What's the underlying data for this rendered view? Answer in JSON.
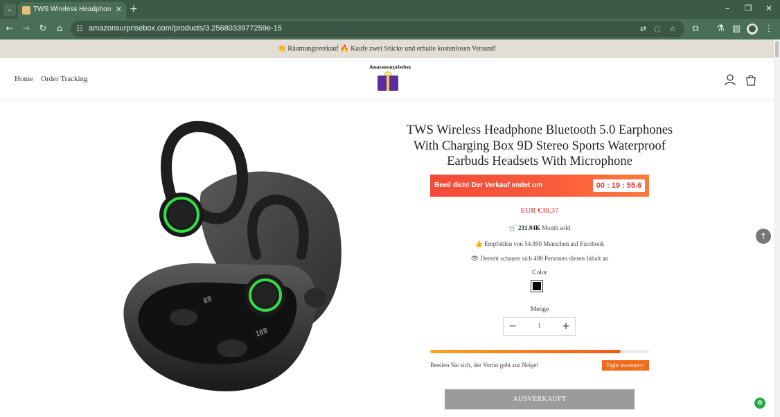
{
  "browser": {
    "tab_title": "TWS Wireless Headphone Blueto",
    "new_tab_icon": "plus-icon",
    "url": "amazonsurprisebox.com/products/3.2568033977259e-15",
    "window_buttons": [
      "minimize-icon",
      "restore-icon",
      "close-icon"
    ]
  },
  "announcement": "👏 Räumungsverkauf 🔥 Kaufe zwei Stücke und erhalte kostenlosen Versand!",
  "nav": {
    "home": "Home",
    "order_tracking": "Order Tracking"
  },
  "logo": {
    "text": "Amazonsurprisebox"
  },
  "product": {
    "title": "TWS Wireless Headphone Bluetooth 5.0 Earphones With Charging Box 9D Stereo Sports Waterproof Earbuds Headsets With Microphone",
    "countdown_label": "Beeil dich! Der Verkauf endet um",
    "countdown_time": "00 : 19 : 55.6",
    "price": "EUR €30,37",
    "sold_count": "231.94K",
    "sold_label": "Month sold",
    "recommended": "Empfohlen von 54.890 Menschen auf Facebook",
    "viewing": "Derzeit schauen sich 498 Personen diesen Inhalt an",
    "color_label": "Color",
    "selected_color": "#000000",
    "quantity_label": "Menge",
    "quantity": "1",
    "stock_level": 0.87,
    "stock_text": "Beeilen Sie sich, der Vorrat geht zur Neige!",
    "stock_badge": "Tight inventory!",
    "sold_out_button": "AUSVERKAUFT"
  },
  "colors": {
    "accent_red": "#e0241f",
    "countdown_gradient": [
      "#f44a3a",
      "#ff7a3d"
    ],
    "badge_orange": "#f36a1a",
    "sold_out_gray": "#9b9b9b"
  }
}
